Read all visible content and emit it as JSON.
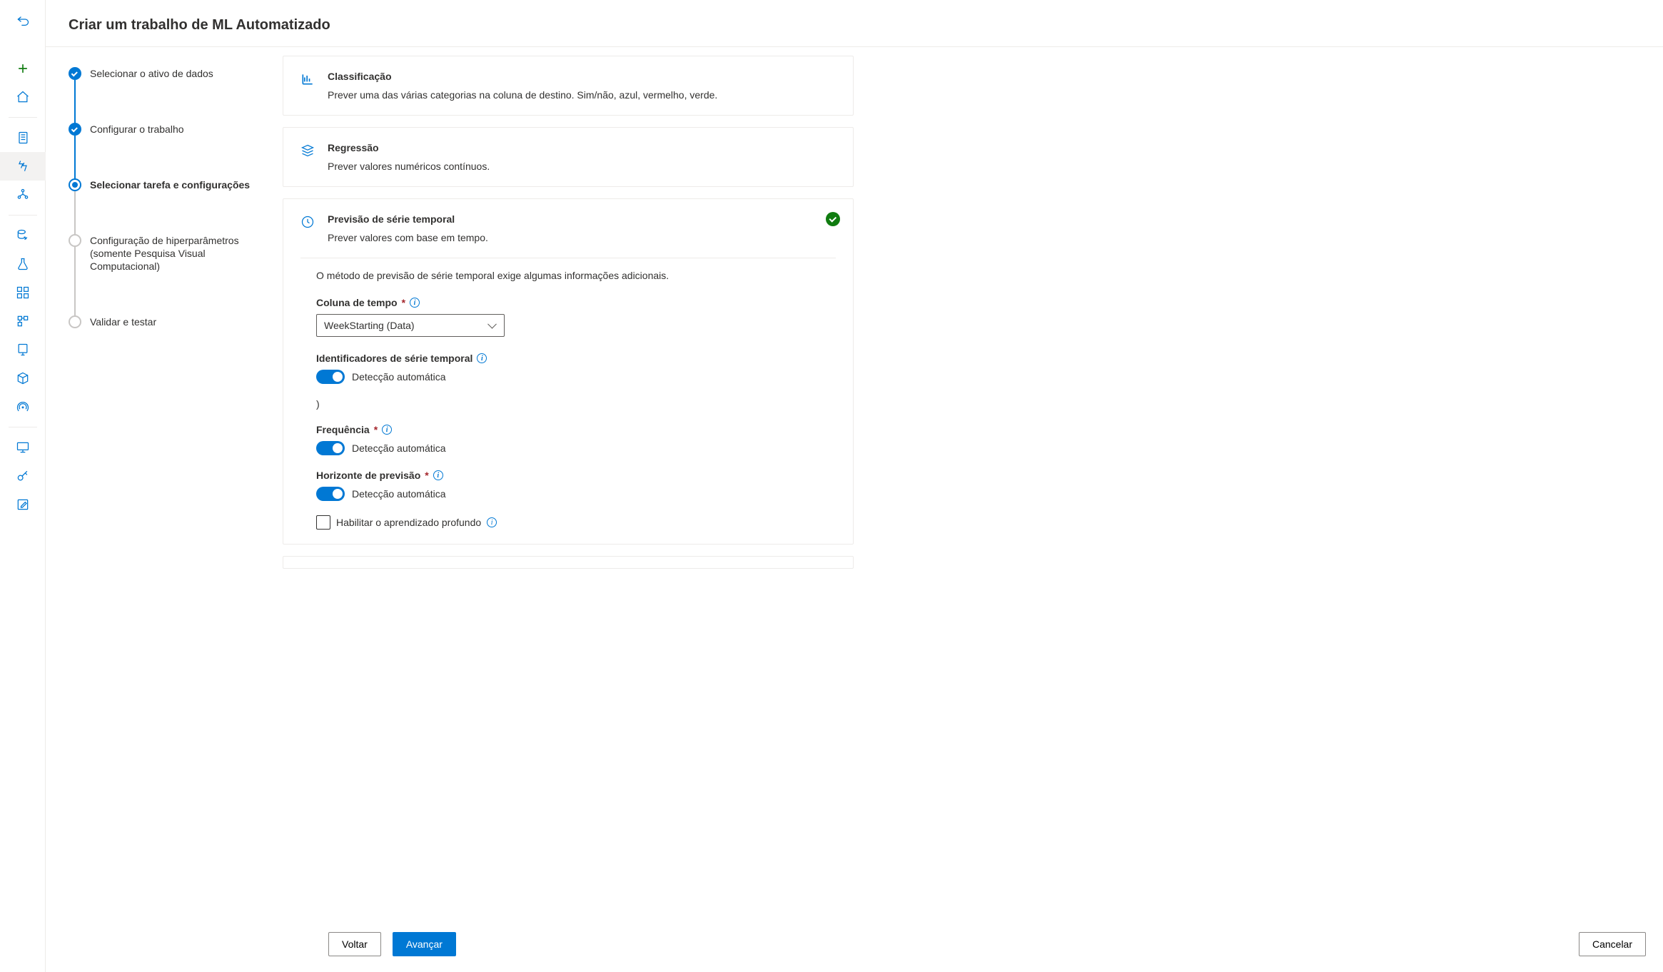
{
  "header": {
    "title": "Criar um trabalho de ML Automatizado"
  },
  "stepper": {
    "steps": [
      {
        "label": "Selecionar o ativo de dados"
      },
      {
        "label": "Configurar o trabalho"
      },
      {
        "label": "Selecionar tarefa e configurações"
      },
      {
        "label": "Configuração de hiperparâmetros (somente Pesquisa Visual Computacional)"
      },
      {
        "label": "Validar e testar"
      }
    ]
  },
  "tasks": {
    "classification": {
      "title": "Classificação",
      "desc": "Prever uma das várias categorias na coluna de destino. Sim/não, azul, vermelho, verde."
    },
    "regression": {
      "title": "Regressão",
      "desc": "Prever valores numéricos contínuos."
    },
    "timeseries": {
      "title": "Previsão de série temporal",
      "desc": "Prever valores com base em tempo.",
      "intro": "O método de previsão de série temporal exige algumas informações adicionais.",
      "timeColumn": {
        "label": "Coluna de tempo",
        "value": "WeekStarting (Data)"
      },
      "seriesId": {
        "label": "Identificadores de série temporal",
        "toggleLabel": "Detecção automática"
      },
      "stray": ")",
      "frequency": {
        "label": "Frequência",
        "toggleLabel": "Detecção automática"
      },
      "horizon": {
        "label": "Horizonte de previsão",
        "toggleLabel": "Detecção automática"
      },
      "deepLearning": {
        "label": "Habilitar o aprendizado profundo"
      }
    }
  },
  "footer": {
    "back": "Voltar",
    "next": "Avançar",
    "cancel": "Cancelar"
  }
}
